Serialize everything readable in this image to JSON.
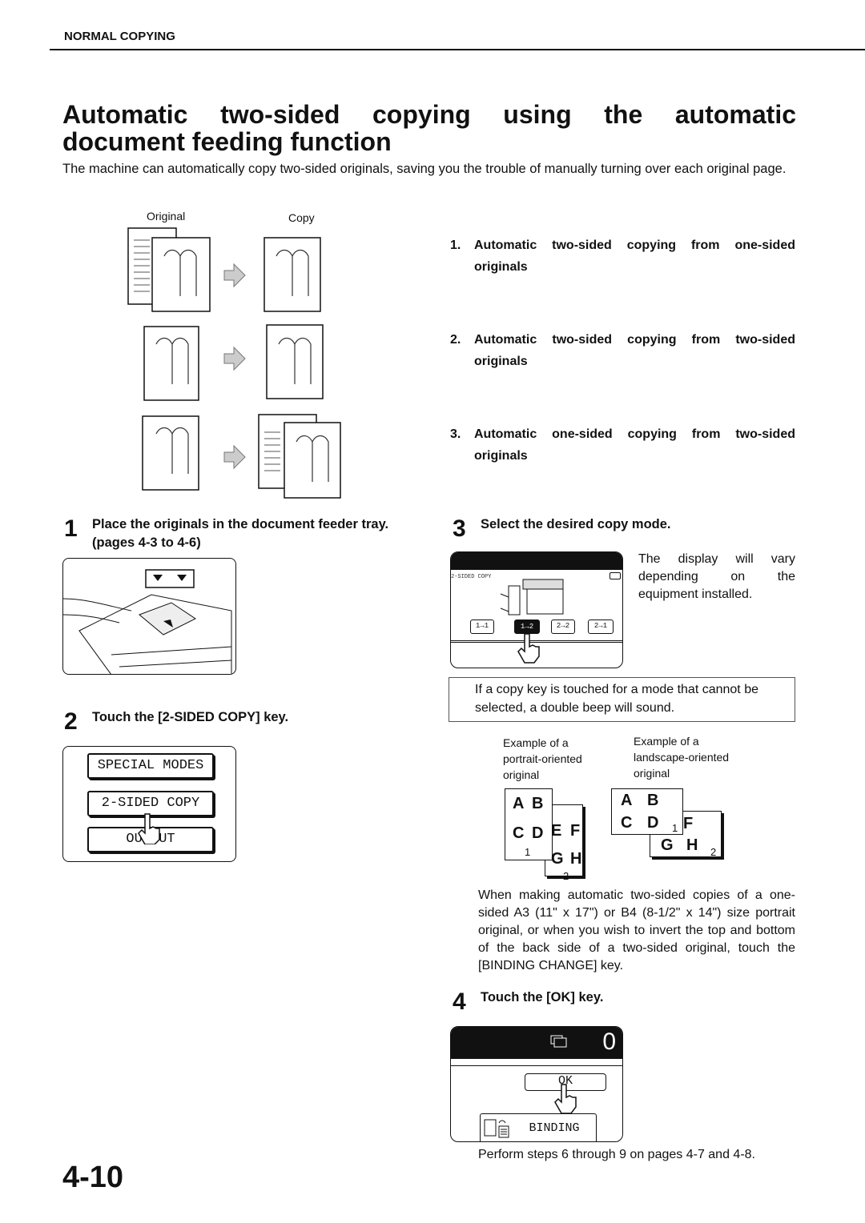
{
  "header": {
    "section": "NORMAL COPYING"
  },
  "title": "Automatic two-sided copying using the automatic document feeding function",
  "intro": "The machine can automatically copy two-sided originals, saving you the trouble of manually turning over each original page.",
  "diagram": {
    "original_label": "Original",
    "copy_label": "Copy"
  },
  "modes": [
    {
      "num": "1.",
      "text": "Automatic two-sided copying from one-sided originals"
    },
    {
      "num": "2.",
      "text": "Automatic two-sided copying from two-sided originals"
    },
    {
      "num": "3.",
      "text": "Automatic one-sided copying from two-sided originals"
    }
  ],
  "steps": [
    {
      "num": "1",
      "text": "Place the originals in the document feeder tray. (pages 4-3 to 4-6)"
    },
    {
      "num": "2",
      "text": "Touch the [2-SIDED COPY] key.",
      "keys": [
        "SPECIAL MODES",
        "2-SIDED COPY",
        "OUTPUT"
      ]
    },
    {
      "num": "3",
      "text": "Select the desired copy mode.",
      "display_label": "2-SIDED COPY",
      "mode_keys": [
        "1→1",
        "1→2",
        "2→2",
        "2→1"
      ],
      "side_text": "The display will vary depending on the equipment installed."
    },
    {
      "num": "4",
      "text": "Touch the [OK] key.",
      "counter": "0",
      "ok": "OK",
      "binding": "BINDING"
    }
  ],
  "note": "If a copy key is touched for a mode that cannot be selected, a double beep will sound.",
  "examples": {
    "portrait": "Example of a portrait-oriented original",
    "landscape": "Example of a landscape-oriented original",
    "letters": [
      "A",
      "B",
      "C",
      "D",
      "E",
      "F",
      "G",
      "H"
    ],
    "pages": [
      "1",
      "2"
    ]
  },
  "binding_para": "When making automatic two-sided copies of a one-sided A3 (11\" x 17\") or B4 (8-1/2\" x 14\") size portrait original, or when you wish to invert the top and bottom of the back side of a two-sided original, touch the [BINDING CHANGE] key.",
  "footer_text": "Perform steps 6 through 9 on pages 4-7 and 4-8.",
  "page_number": "4-10"
}
